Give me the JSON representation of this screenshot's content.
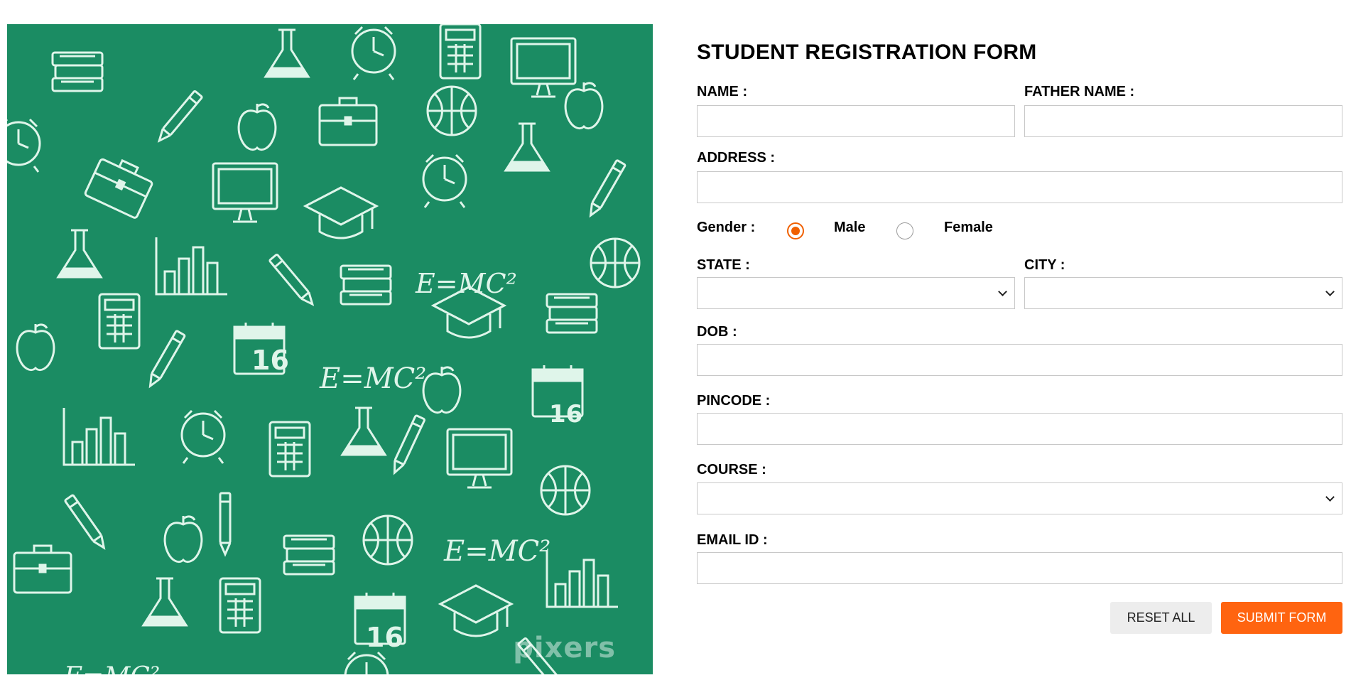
{
  "hero_image": {
    "watermark": "pixers",
    "background_color": "#1b8c63",
    "chalk_texts": [
      "E=MC²",
      "E=MC²",
      "E=MC²",
      "E=MC²",
      "16",
      "16",
      "16"
    ]
  },
  "form": {
    "title": "STUDENT REGISTRATION FORM",
    "labels": {
      "name": "NAME :",
      "father_name": "FATHER NAME :",
      "address": "ADDRESS :",
      "gender": "Gender :",
      "state": "STATE :",
      "city": "CITY :",
      "dob": "DOB :",
      "pincode": "PINCODE :",
      "course": "COURSE :",
      "email": "EMAIL ID :"
    },
    "gender_options": [
      {
        "label": "Male",
        "selected": true
      },
      {
        "label": "Female",
        "selected": false
      }
    ],
    "values": {
      "name": "",
      "father_name": "",
      "address": "",
      "state": "",
      "city": "",
      "dob": "",
      "pincode": "",
      "course": "",
      "email": ""
    },
    "buttons": {
      "reset": "RESET ALL",
      "submit": "SUBMIT FORM"
    },
    "colors": {
      "accent": "#ff6410",
      "reset_bg": "#ededed",
      "field_border": "#c8c8c8"
    }
  }
}
